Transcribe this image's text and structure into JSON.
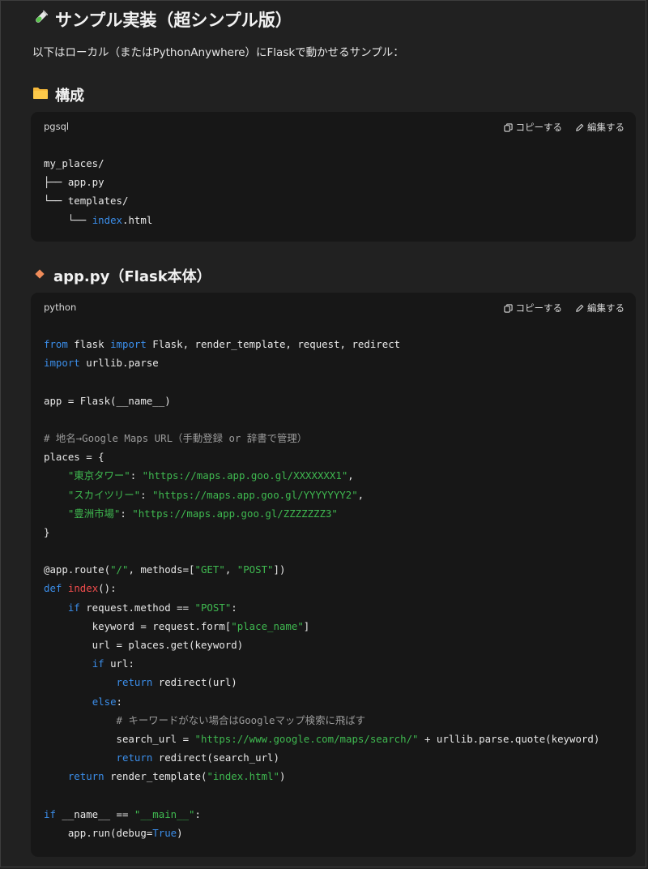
{
  "heading": "サンプル実装（超シンプル版）",
  "intro": "以下はローカル（またはPythonAnywhere）にFlaskで動かせるサンプル：",
  "section1_title": "構成",
  "section2_title": "app.py（Flask本体）",
  "icons": {
    "heading": "test-tube-icon",
    "section1": "folder-icon",
    "section2": "orange-diamond-icon",
    "copy": "copy-icon",
    "edit": "pencil-icon"
  },
  "code_actions": {
    "copy": "コピーする",
    "edit": "編集する"
  },
  "block1": {
    "lang": "pgsql",
    "lines": [
      [
        {
          "t": "my_places/"
        }
      ],
      [
        {
          "t": "├── app.py"
        }
      ],
      [
        {
          "t": "└── templates/"
        }
      ],
      [
        {
          "t": "    └── "
        },
        {
          "t": "index",
          "c": "bl"
        },
        {
          "t": ".html"
        }
      ]
    ]
  },
  "block2": {
    "lang": "python",
    "lines": [
      [
        {
          "t": "from",
          "c": "kw"
        },
        {
          "t": " flask "
        },
        {
          "t": "import",
          "c": "kw"
        },
        {
          "t": " Flask, render_template, request, redirect"
        }
      ],
      [
        {
          "t": "import",
          "c": "kw"
        },
        {
          "t": " urllib.parse"
        }
      ],
      [],
      [
        {
          "t": "app = Flask(__name__)"
        }
      ],
      [],
      [
        {
          "t": "# 地名→Google Maps URL（手動登録 or 辞書で管理）",
          "c": "cm"
        }
      ],
      [
        {
          "t": "places = {"
        }
      ],
      [
        {
          "t": "    "
        },
        {
          "t": "\"東京タワー\"",
          "c": "str"
        },
        {
          "t": ": "
        },
        {
          "t": "\"https://maps.app.goo.gl/XXXXXXX1\"",
          "c": "str"
        },
        {
          "t": ","
        }
      ],
      [
        {
          "t": "    "
        },
        {
          "t": "\"スカイツリー\"",
          "c": "str"
        },
        {
          "t": ": "
        },
        {
          "t": "\"https://maps.app.goo.gl/YYYYYYY2\"",
          "c": "str"
        },
        {
          "t": ","
        }
      ],
      [
        {
          "t": "    "
        },
        {
          "t": "\"豊洲市場\"",
          "c": "str"
        },
        {
          "t": ": "
        },
        {
          "t": "\"https://maps.app.goo.gl/ZZZZZZZ3\"",
          "c": "str"
        }
      ],
      [
        {
          "t": "}"
        }
      ],
      [],
      [
        {
          "t": "@app.route("
        },
        {
          "t": "\"/\"",
          "c": "str"
        },
        {
          "t": ", methods=["
        },
        {
          "t": "\"GET\"",
          "c": "str"
        },
        {
          "t": ", "
        },
        {
          "t": "\"POST\"",
          "c": "str"
        },
        {
          "t": "])"
        }
      ],
      [
        {
          "t": "def",
          "c": "kw"
        },
        {
          "t": " "
        },
        {
          "t": "index",
          "c": "fn"
        },
        {
          "t": "():"
        }
      ],
      [
        {
          "t": "    "
        },
        {
          "t": "if",
          "c": "kw"
        },
        {
          "t": " request.method == "
        },
        {
          "t": "\"POST\"",
          "c": "str"
        },
        {
          "t": ":"
        }
      ],
      [
        {
          "t": "        keyword = request.form["
        },
        {
          "t": "\"place_name\"",
          "c": "str"
        },
        {
          "t": "]"
        }
      ],
      [
        {
          "t": "        url = places.get(keyword)"
        }
      ],
      [
        {
          "t": "        "
        },
        {
          "t": "if",
          "c": "kw"
        },
        {
          "t": " url:"
        }
      ],
      [
        {
          "t": "            "
        },
        {
          "t": "return",
          "c": "kw"
        },
        {
          "t": " redirect(url)"
        }
      ],
      [
        {
          "t": "        "
        },
        {
          "t": "else",
          "c": "kw"
        },
        {
          "t": ":"
        }
      ],
      [
        {
          "t": "            "
        },
        {
          "t": "# キーワードがない場合はGoogleマップ検索に飛ばす",
          "c": "cm"
        }
      ],
      [
        {
          "t": "            search_url = "
        },
        {
          "t": "\"https://www.google.com/maps/search/\"",
          "c": "str"
        },
        {
          "t": " + urllib.parse.quote(keyword)"
        }
      ],
      [
        {
          "t": "            "
        },
        {
          "t": "return",
          "c": "kw"
        },
        {
          "t": " redirect(search_url)"
        }
      ],
      [
        {
          "t": "    "
        },
        {
          "t": "return",
          "c": "kw"
        },
        {
          "t": " render_template("
        },
        {
          "t": "\"index.html\"",
          "c": "str"
        },
        {
          "t": ")"
        }
      ],
      [],
      [
        {
          "t": "if",
          "c": "kw"
        },
        {
          "t": " __name__ == "
        },
        {
          "t": "\"__main__\"",
          "c": "str"
        },
        {
          "t": ":"
        }
      ],
      [
        {
          "t": "    app.run(debug="
        },
        {
          "t": "True",
          "c": "kw"
        },
        {
          "t": ")"
        }
      ]
    ]
  }
}
